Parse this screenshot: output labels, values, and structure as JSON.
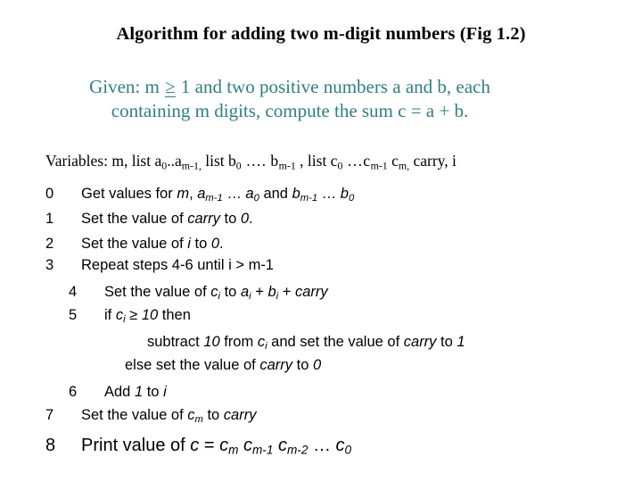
{
  "slide": {
    "title": "Algorithm for adding two m-digit numbers (Fig 1.2)",
    "given_line1_a": "Given: m ",
    "given_ge": "≥",
    "given_line1_b": " 1 and two positive numbers a and b, each",
    "given_line2": "containing m digits, compute the sum c = a + b.",
    "accent_color": "#2d807f",
    "text_color": "#000000",
    "background_color": "#ffffff",
    "variables": {
      "label": "Variables: m, list a",
      "sub_a0": "0",
      "mid_a": "..a",
      "sub_am1": "m-1,",
      "list_b": " list  b",
      "sub_b0": "0",
      "dots_b": " …. b",
      "sub_bm1": "m-1",
      "list_c": " , list c",
      "sub_c0": "0",
      "dots_c": "  …c",
      "sub_cm1": "m-1",
      "c_last": " c",
      "sub_cm": "m,",
      "tail": " carry, i"
    },
    "steps": [
      {
        "num": "0",
        "level": 1,
        "parts": [
          {
            "t": "Get values for ",
            "style": "normal"
          },
          {
            "t": "m",
            "style": "italic"
          },
          {
            "t": ", ",
            "style": "normal"
          },
          {
            "t": "a",
            "style": "italic"
          },
          {
            "t": "m-1",
            "style": "sub"
          },
          {
            "t": " … ",
            "style": "normal"
          },
          {
            "t": "a",
            "style": "italic"
          },
          {
            "t": "0",
            "style": "sub"
          },
          {
            "t": " and ",
            "style": "normal"
          },
          {
            "t": "b",
            "style": "italic"
          },
          {
            "t": "m-1",
            "style": "sub"
          },
          {
            "t": " … ",
            "style": "normal"
          },
          {
            "t": "b",
            "style": "italic"
          },
          {
            "t": "0",
            "style": "sub"
          }
        ]
      },
      {
        "num": "1",
        "level": 1,
        "parts": [
          {
            "t": "Set the value of ",
            "style": "normal"
          },
          {
            "t": "carry",
            "style": "italic"
          },
          {
            "t": " to ",
            "style": "normal"
          },
          {
            "t": "0",
            "style": "italic"
          },
          {
            "t": ".",
            "style": "normal"
          }
        ]
      },
      {
        "num": "2",
        "level": 1,
        "parts": [
          {
            "t": "Set the value of ",
            "style": "normal"
          },
          {
            "t": "i",
            "style": "italic"
          },
          {
            "t": " to ",
            "style": "normal"
          },
          {
            "t": "0",
            "style": "italic"
          },
          {
            "t": ".",
            "style": "normal"
          }
        ]
      },
      {
        "num": "3",
        "level": 1,
        "parts": [
          {
            "t": "Repeat steps 4-6 until i > m-1",
            "style": "normal"
          }
        ]
      },
      {
        "num": "4",
        "level": 2,
        "parts": [
          {
            "t": "Set the value of ",
            "style": "normal"
          },
          {
            "t": "c",
            "style": "italic"
          },
          {
            "t": "i",
            "style": "sub"
          },
          {
            "t": " to ",
            "style": "normal"
          },
          {
            "t": "a",
            "style": "italic"
          },
          {
            "t": "i",
            "style": "sub"
          },
          {
            "t": " + ",
            "style": "normal"
          },
          {
            "t": "b",
            "style": "italic"
          },
          {
            "t": "i",
            "style": "sub"
          },
          {
            "t": " + ",
            "style": "normal"
          },
          {
            "t": "carry",
            "style": "italic"
          }
        ]
      },
      {
        "num": "5",
        "level": 2,
        "parts": [
          {
            "t": "if ",
            "style": "normal"
          },
          {
            "t": "c",
            "style": "italic"
          },
          {
            "t": "i",
            "style": "sub"
          },
          {
            "t": " ≥ ",
            "style": "normal"
          },
          {
            "t": "10",
            "style": "italic"
          },
          {
            "t": " then",
            "style": "normal"
          }
        ]
      },
      {
        "num": "",
        "level": 0,
        "indent": 165,
        "parts": [
          {
            "t": "subtract ",
            "style": "normal"
          },
          {
            "t": "10",
            "style": "italic"
          },
          {
            "t": " from ",
            "style": "normal"
          },
          {
            "t": "c",
            "style": "italic"
          },
          {
            "t": "i",
            "style": "sub"
          },
          {
            "t": " and set the value of ",
            "style": "normal"
          },
          {
            "t": "carry",
            "style": "italic"
          },
          {
            "t": " to ",
            "style": "normal"
          },
          {
            "t": "1",
            "style": "italic"
          }
        ]
      },
      {
        "num": "",
        "level": 0,
        "indent": 140,
        "parts": [
          {
            "t": "else set the value of ",
            "style": "normal"
          },
          {
            "t": "carry",
            "style": "italic"
          },
          {
            "t": " to ",
            "style": "normal"
          },
          {
            "t": "0",
            "style": "italic"
          }
        ]
      },
      {
        "num": "6",
        "level": 2,
        "parts": [
          {
            "t": "Add ",
            "style": "normal"
          },
          {
            "t": "1",
            "style": "italic"
          },
          {
            "t": " to ",
            "style": "normal"
          },
          {
            "t": "i",
            "style": "italic"
          }
        ]
      },
      {
        "num": "7",
        "level": 1,
        "parts": [
          {
            "t": "Set the value of ",
            "style": "normal"
          },
          {
            "t": "c",
            "style": "italic"
          },
          {
            "t": "m",
            "style": "sub"
          },
          {
            "t": " to ",
            "style": "normal"
          },
          {
            "t": "carry",
            "style": "italic"
          }
        ]
      },
      {
        "num": "8",
        "level": 1,
        "big": true,
        "parts": [
          {
            "t": "Print value of ",
            "style": "normal"
          },
          {
            "t": "c",
            "style": "italic"
          },
          {
            "t": " = ",
            "style": "normal"
          },
          {
            "t": "c",
            "style": "italic"
          },
          {
            "t": "m",
            "style": "sub"
          },
          {
            "t": " ",
            "style": "normal"
          },
          {
            "t": "c",
            "style": "italic"
          },
          {
            "t": "m-1",
            "style": "sub"
          },
          {
            "t": " ",
            "style": "normal"
          },
          {
            "t": "c",
            "style": "italic"
          },
          {
            "t": "m-2",
            "style": "sub"
          },
          {
            "t": " … ",
            "style": "normal"
          },
          {
            "t": "c",
            "style": "italic"
          },
          {
            "t": "0",
            "style": "sub"
          }
        ]
      }
    ]
  }
}
